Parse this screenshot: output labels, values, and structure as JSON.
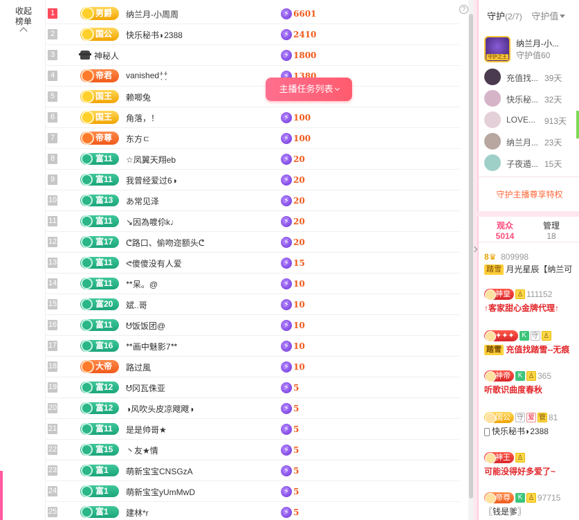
{
  "collapse": {
    "label_1": "收起",
    "label_2": "榜单"
  },
  "help": "?",
  "task_button": "主播任务列表",
  "rank": [
    {
      "no": "1",
      "badge": "男爵",
      "kind": "noble-gold",
      "name": "纳兰月-小周周",
      "score": "6601"
    },
    {
      "no": "2",
      "badge": "国公",
      "kind": "noble-gold",
      "name": "快乐秘书◗2388",
      "score": "2410"
    },
    {
      "no": "3",
      "badge": "",
      "kind": "mystery",
      "name": "神秘人",
      "score": "1800"
    },
    {
      "no": "4",
      "badge": "帝君",
      "kind": "noble-orange",
      "name": "vanished⁺̣̇⁺̣̇",
      "score": "1380"
    },
    {
      "no": "5",
      "badge": "国王",
      "kind": "noble-gold",
      "name": "赖唧兔",
      "score": ""
    },
    {
      "no": "6",
      "badge": "国王",
      "kind": "noble-gold",
      "name": "角落，！",
      "score": "100"
    },
    {
      "no": "7",
      "badge": "帝尊",
      "kind": "noble-orange",
      "name": "东方ㄷ",
      "score": "100"
    },
    {
      "no": "8",
      "badge": "富11",
      "kind": "wealth",
      "name": "☆凤翼天翔eb",
      "score": "20"
    },
    {
      "no": "9",
      "badge": "富11",
      "kind": "wealth",
      "name": "我曾经爱过6◑",
      "score": "20"
    },
    {
      "no": "10",
      "badge": "富13",
      "kind": "wealth",
      "name": "あ常见泽",
      "score": "20"
    },
    {
      "no": "11",
      "badge": "富11",
      "kind": "wealth",
      "name": "↘因為喥伱k♩",
      "score": "20"
    },
    {
      "no": "12",
      "badge": "富17",
      "kind": "wealth",
      "name": "ᕦ路口、偷吻迩额头ᕦ",
      "score": "20"
    },
    {
      "no": "13",
      "badge": "富11",
      "kind": "wealth",
      "name": "ᕙ傻傻没有人爱",
      "score": "15"
    },
    {
      "no": "14",
      "badge": "富11",
      "kind": "wealth",
      "name": "ᕯ呆。@",
      "score": "10"
    },
    {
      "no": "15",
      "badge": "富20",
      "kind": "wealth",
      "name": "斌..哥",
      "score": "10"
    },
    {
      "no": "16",
      "badge": "富11",
      "kind": "wealth",
      "name": "ᕰ饭饭团@",
      "score": "10"
    },
    {
      "no": "17",
      "badge": "富16",
      "kind": "wealth",
      "name": "ᕯ画中魅影7ᕯ",
      "score": "10"
    },
    {
      "no": "18",
      "badge": "大帝",
      "kind": "noble-orange",
      "name": "路过風",
      "score": "10"
    },
    {
      "no": "19",
      "badge": "富12",
      "kind": "wealth",
      "name": "ᕰ冈瓦侏亚",
      "score": "5"
    },
    {
      "no": "20",
      "badge": "富12",
      "kind": "wealth",
      "name": "◑风吹头皮凉飕飕◑",
      "score": "5"
    },
    {
      "no": "21",
      "badge": "富11",
      "kind": "wealth",
      "name": "是是帅哥★",
      "score": "5"
    },
    {
      "no": "22",
      "badge": "富15",
      "kind": "wealth",
      "name": "丶友★情",
      "score": "5"
    },
    {
      "no": "23",
      "badge": "富1",
      "kind": "wealth",
      "name": "萌新宝宝CNSGzA",
      "score": "5"
    },
    {
      "no": "24",
      "badge": "富1",
      "kind": "wealth",
      "name": "萌新宝宝yUmMwD",
      "score": "5"
    },
    {
      "no": "25",
      "badge": "富1",
      "kind": "wealth",
      "name": "建林*r",
      "score": "5"
    }
  ],
  "guard": {
    "tab_label": "守护",
    "tab_count": "(2/7)",
    "tab2_label": "守护值",
    "top": {
      "name": "纳兰月-小...",
      "value": "守护值60",
      "badge": "守护之王"
    },
    "rows": [
      {
        "name": "充值找...",
        "days": "39天"
      },
      {
        "name": "快乐秘...",
        "days": "32天"
      },
      {
        "name": "LOVE...",
        "days": "913天"
      },
      {
        "name": "纳兰月...",
        "days": "23天"
      },
      {
        "name": "子夜遁...",
        "days": "15天"
      }
    ],
    "privilege": "守护主播尊享特权"
  },
  "audience": {
    "tab1_label": "观众",
    "tab1_count": "5014",
    "tab2_label": "管理",
    "tab2_count": "18"
  },
  "messages": {
    "m1_prefix": "8",
    "m1_uid": "809998",
    "m1_ticket": "踏雪",
    "m1_text": "月光星辰【纳兰可",
    "m2_level": "神皇",
    "m2_uid": "111152",
    "m2_text": "↑客家甜心金牌代理↑",
    "m3_ticket": "踏雪",
    "m3_text": "充值找踏雪--无痕",
    "m4_level": "神帝",
    "m4_uid": "365",
    "m4_text": "听歌识曲度春秋",
    "m5_level": "国公",
    "m5_uid": "81",
    "m5_text": "快乐秘书◗2388",
    "m6_level": "神王",
    "m6_text": "可能没得好多爱了~",
    "m7_level": "帝尊",
    "m7_uid": "97715",
    "m7_text": "〖钱是爹〗",
    "tag_guard": "守",
    "tag_k": "K",
    "tag_manage": "管",
    "tag_love": "爱"
  },
  "colors": {
    "accent": "#ff5a8a",
    "score": "#f05a1a",
    "wealth": "#1aa57a",
    "noble": "#f2a400"
  }
}
